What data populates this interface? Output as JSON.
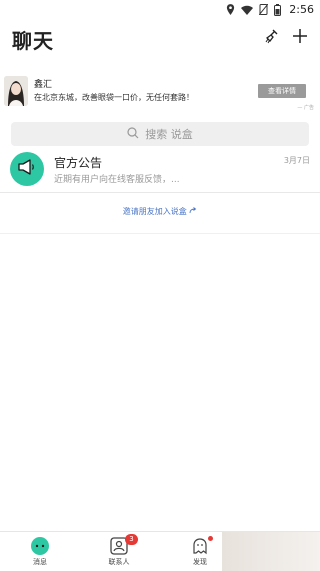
{
  "status_bar": {
    "time": "2:56"
  },
  "header": {
    "title": "聊天"
  },
  "ad": {
    "name": "鑫汇",
    "text": "在北京东城，改善眼袋一口价，无任何套路！",
    "button": "查看详情",
    "tag": "广告"
  },
  "search": {
    "placeholder": "搜索 说盒"
  },
  "chats": [
    {
      "title": "官方公告",
      "preview": "近期有用户向在线客服反馈，...",
      "time": "3月7日"
    }
  ],
  "invite": {
    "text": "邀请朋友加入说盒"
  },
  "nav": {
    "messages": "消息",
    "contacts": "联系人",
    "contacts_badge": "3",
    "discover": "发现"
  },
  "colors": {
    "accent": "#2ec7a3",
    "badge": "#e53935",
    "link": "#4a76c6"
  }
}
